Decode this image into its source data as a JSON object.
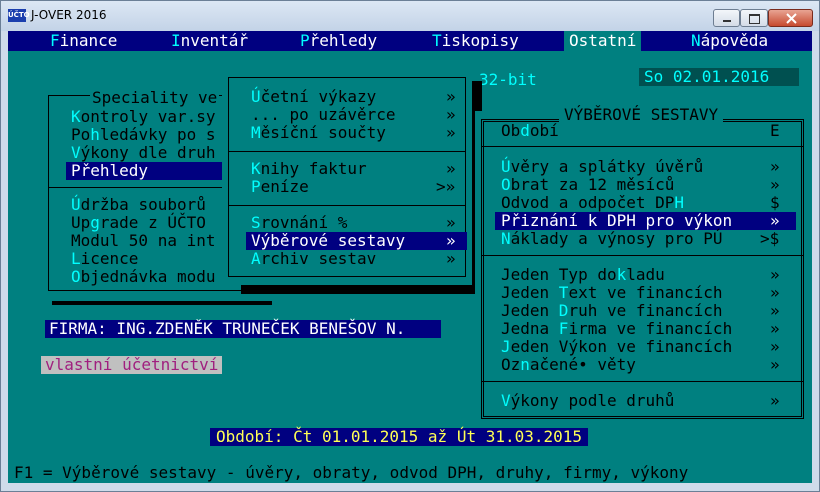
{
  "window": {
    "title": "J-OVER 2016",
    "icon_text": "ÚČTO"
  },
  "menubar": {
    "items": [
      {
        "hot": "F",
        "rest": "inance"
      },
      {
        "hot": "I",
        "rest": "nventář"
      },
      {
        "hot": "P",
        "rest": "řehledy"
      },
      {
        "hot": "T",
        "rest": "iskopisy"
      },
      {
        "hot": "",
        "rest": "Ostatní"
      },
      {
        "hot": "N",
        "rest": "ápověda"
      }
    ]
  },
  "header": {
    "bits": "32-bit",
    "date": "So 02.01.2016"
  },
  "panel1": {
    "title": "Speciality ve",
    "items": [
      {
        "hot": "K",
        "rest": "ontroly var.sy"
      },
      {
        "pre": "Po",
        "hot": "h",
        "rest": "ledávky po s"
      },
      {
        "hot": "V",
        "rest": "ýkony dle druh"
      },
      {
        "hot": "",
        "rest": "Přehledy"
      },
      {
        "hot": "Ú",
        "rest": "držba souborů"
      },
      {
        "pre": "Up",
        "hot": "g",
        "rest": "rade z ÚČTO"
      },
      {
        "hot": "",
        "rest": "Modul 50 na int"
      },
      {
        "hot": "L",
        "rest": "icence"
      },
      {
        "hot": "O",
        "rest": "bjednávka modu"
      }
    ]
  },
  "panel2": {
    "items": [
      {
        "hot": "Ú",
        "rest": "četní výkazy",
        "arrow": "»"
      },
      {
        "hot": "",
        "rest": "... po uzávěrce",
        "arrow": "»"
      },
      {
        "hot": "M",
        "rest": "ěsíční součty",
        "arrow": "»"
      },
      {
        "hot": "K",
        "rest": "nihy faktur",
        "arrow": "»"
      },
      {
        "hot": "P",
        "rest": "eníze",
        "arrow": ">»"
      },
      {
        "hot": "S",
        "rest": "rovnání %",
        "arrow": "»"
      },
      {
        "hot": "",
        "rest": "Výběrové sestavy",
        "arrow": "»"
      },
      {
        "hot": "A",
        "rest": "rchiv sestav",
        "arrow": "»"
      }
    ]
  },
  "panel3": {
    "title": "VÝBĚROVÉ SESTAVY",
    "items": [
      {
        "pre": "Ob",
        "hot": "d",
        "rest": "obí",
        "arrow": "E"
      },
      {
        "hot": "Ú",
        "rest": "věry a splátky úvěrů",
        "arrow": "»"
      },
      {
        "hot": "O",
        "rest": "brat za 12 měsíců",
        "arrow": "»"
      },
      {
        "pre": "Odvod a odpočet DP",
        "hot": "H",
        "rest": "",
        "arrow": "$"
      },
      {
        "hot": "",
        "rest": "Přiznání k DPH pro výkon",
        "arrow": "»"
      },
      {
        "hot": "N",
        "rest": "áklady a výnosy pro PÚ",
        "arrow": ">$"
      },
      {
        "pre": "Jeden Typ do",
        "hot": "k",
        "rest": "ladu",
        "arrow": "»"
      },
      {
        "pre": "Jeden ",
        "hot": "T",
        "rest": "ext ve financích",
        "arrow": "»"
      },
      {
        "pre": "Jeden ",
        "hot": "D",
        "rest": "ruh ve financích",
        "arrow": "»"
      },
      {
        "pre": "Jedna ",
        "hot": "F",
        "rest": "irma ve financích",
        "arrow": "»"
      },
      {
        "pre": "",
        "hot": "J",
        "rest": "eden Výkon ve financích",
        "arrow": "»"
      },
      {
        "pre": "Oz",
        "hot": "n",
        "rest": "ačené• věty",
        "arrow": "»"
      },
      {
        "hot": "V",
        "rest": "ýkony podle druhů",
        "arrow": "»"
      }
    ]
  },
  "firm": "FIRMA: ING.ZDENĚK TRUNEČEK BENEŠOV N.",
  "accounting_type": "vlastní účetnictví",
  "period": "Období: Čt 01.01.2015 až Út 31.03.2015",
  "status": "F1 = Výběrové sestavy - úvěry, obraty, odvod DPH, druhy, firmy, výkony"
}
